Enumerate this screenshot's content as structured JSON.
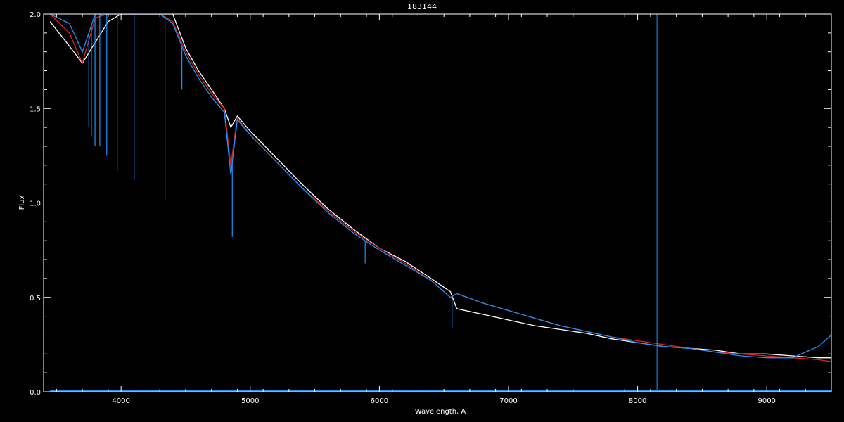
{
  "chart_data": {
    "type": "line",
    "title": "183144",
    "xlabel": "Wavelength, A",
    "ylabel": "Flux",
    "xlim": [
      3400,
      9500
    ],
    "ylim": [
      0.0,
      2.0
    ],
    "xticks": [
      4000,
      5000,
      6000,
      7000,
      8000,
      9000
    ],
    "xtick_labels": [
      "4000",
      "5000",
      "6000",
      "7000",
      "8000",
      "9000"
    ],
    "yticks": [
      0.0,
      0.5,
      1.0,
      1.5,
      2.0
    ],
    "ytick_labels": [
      "0.0",
      "0.5",
      "1.0",
      "1.5",
      "2.0"
    ],
    "grid": false,
    "colors": {
      "background": "#000000",
      "axes": "#ffffff",
      "observed": "#ffffff",
      "model": "#dd2222",
      "spectrum": "#1e90ff"
    },
    "series": [
      {
        "color": "#ffffff",
        "x": [
          3450,
          3600,
          3700,
          3800,
          3900,
          4000,
          4100,
          4200,
          4300,
          4400,
          4500,
          4600,
          4700,
          4800,
          4850,
          4900,
          5000,
          5200,
          5400,
          5600,
          5800,
          6000,
          6200,
          6400,
          6550,
          6600,
          6800,
          7000,
          7200,
          7400,
          7600,
          7800,
          8000,
          8200,
          8400,
          8600,
          8800,
          9000,
          9200,
          9400,
          9500
        ],
        "y": [
          1.96,
          1.83,
          1.74,
          1.85,
          1.96,
          2.05,
          2.1,
          2.12,
          2.1,
          2.05,
          1.82,
          1.7,
          1.6,
          1.5,
          1.4,
          1.46,
          1.38,
          1.24,
          1.1,
          0.97,
          0.86,
          0.76,
          0.69,
          0.6,
          0.53,
          0.44,
          0.41,
          0.38,
          0.35,
          0.33,
          0.31,
          0.28,
          0.26,
          0.24,
          0.23,
          0.22,
          0.2,
          0.2,
          0.19,
          0.18,
          0.18
        ]
      },
      {
        "color": "#dd2222",
        "x": [
          3450,
          3600,
          3700,
          3800,
          3900,
          4000,
          4100,
          4200,
          4300,
          4400,
          4500,
          4600,
          4700,
          4800,
          4850,
          4900,
          5000,
          5200,
          5400,
          5600,
          5800,
          6000,
          6200,
          6400,
          6550,
          6600,
          6800,
          7000,
          7200,
          7400,
          7600,
          7800,
          8000,
          8200,
          8400,
          8600,
          8800,
          9000,
          9200,
          9400,
          9500
        ],
        "y": [
          2.02,
          1.9,
          1.74,
          1.98,
          2.08,
          2.15,
          2.18,
          2.14,
          2.08,
          1.96,
          1.8,
          1.68,
          1.58,
          1.5,
          1.2,
          1.45,
          1.36,
          1.22,
          1.08,
          0.96,
          0.85,
          0.76,
          0.68,
          0.59,
          0.5,
          0.52,
          0.47,
          0.43,
          0.39,
          0.35,
          0.32,
          0.29,
          0.27,
          0.25,
          0.23,
          0.21,
          0.2,
          0.19,
          0.18,
          0.17,
          0.16
        ]
      },
      {
        "color": "#1e90ff",
        "x": [
          3450,
          3600,
          3700,
          3800,
          3900,
          4000,
          4100,
          4200,
          4300,
          4400,
          4500,
          4600,
          4700,
          4800,
          4850,
          4900,
          5000,
          5200,
          5400,
          5600,
          5800,
          6000,
          6200,
          6400,
          6550,
          6600,
          6800,
          7000,
          7200,
          7400,
          7600,
          7800,
          8000,
          8200,
          8400,
          8600,
          8800,
          9000,
          9200,
          9400,
          9500
        ],
        "y": [
          2.05,
          1.95,
          1.8,
          2.0,
          2.1,
          2.15,
          2.18,
          2.14,
          2.08,
          1.95,
          1.78,
          1.66,
          1.56,
          1.48,
          1.15,
          1.44,
          1.36,
          1.22,
          1.08,
          0.95,
          0.84,
          0.75,
          0.67,
          0.59,
          0.5,
          0.52,
          0.47,
          0.43,
          0.39,
          0.35,
          0.32,
          0.29,
          0.26,
          0.24,
          0.23,
          0.21,
          0.19,
          0.18,
          0.18,
          0.24,
          0.3
        ]
      },
      {
        "color": "#1e90ff",
        "x": [
          3450,
          9500
        ],
        "y": [
          0.005,
          0.005
        ]
      }
    ],
    "absorption_lines": [
      {
        "x": 3750,
        "min": 1.4,
        "color": "#1e90ff"
      },
      {
        "x": 3770,
        "min": 1.35,
        "color": "#1e90ff"
      },
      {
        "x": 3798,
        "min": 1.3,
        "color": "#1e90ff"
      },
      {
        "x": 3835,
        "min": 1.3,
        "color": "#1e90ff"
      },
      {
        "x": 3889,
        "min": 1.25,
        "color": "#1e90ff"
      },
      {
        "x": 3970,
        "min": 1.17,
        "color": "#1e90ff"
      },
      {
        "x": 4101,
        "min": 1.12,
        "color": "#1e90ff"
      },
      {
        "x": 4340,
        "min": 1.02,
        "color": "#1e90ff"
      },
      {
        "x": 4471,
        "min": 1.6,
        "color": "#1e90ff"
      },
      {
        "x": 4861,
        "min": 0.82,
        "color": "#1e90ff"
      },
      {
        "x": 5890,
        "min": 0.68,
        "color": "#1e90ff"
      },
      {
        "x": 6563,
        "min": 0.34,
        "color": "#1e90ff"
      }
    ],
    "vertical_lines": [
      {
        "x": 8150,
        "color": "#1e90ff"
      }
    ]
  }
}
